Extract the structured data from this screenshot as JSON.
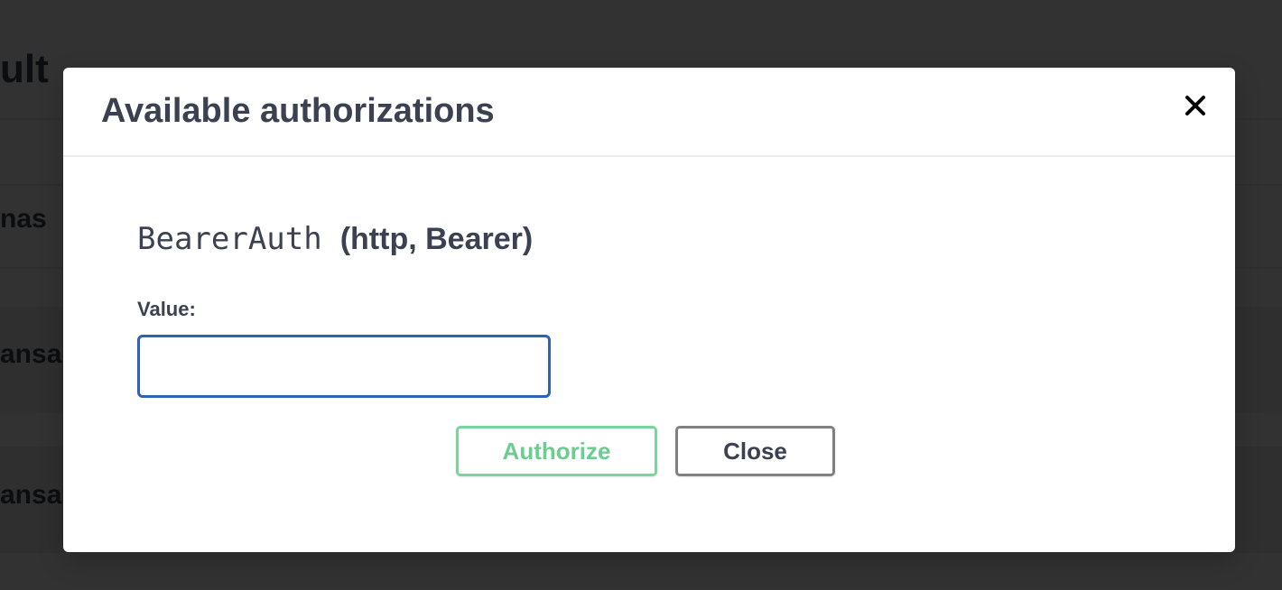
{
  "background": {
    "heading_fragment": "ult",
    "schemas_fragment": "nas",
    "op1_fragment": "ansa",
    "op2_fragment": "ansa"
  },
  "modal": {
    "title": "Available authorizations",
    "close_icon": "close-icon"
  },
  "auth": {
    "scheme_name": "BearerAuth",
    "scheme_type": "(http, Bearer)",
    "value_label": "Value:",
    "value": "",
    "placeholder": ""
  },
  "buttons": {
    "authorize_label": "Authorize",
    "close_label": "Close"
  },
  "colors": {
    "authorize": "#7bd49a",
    "input_border": "#2e62b6",
    "text": "#3b4151"
  }
}
